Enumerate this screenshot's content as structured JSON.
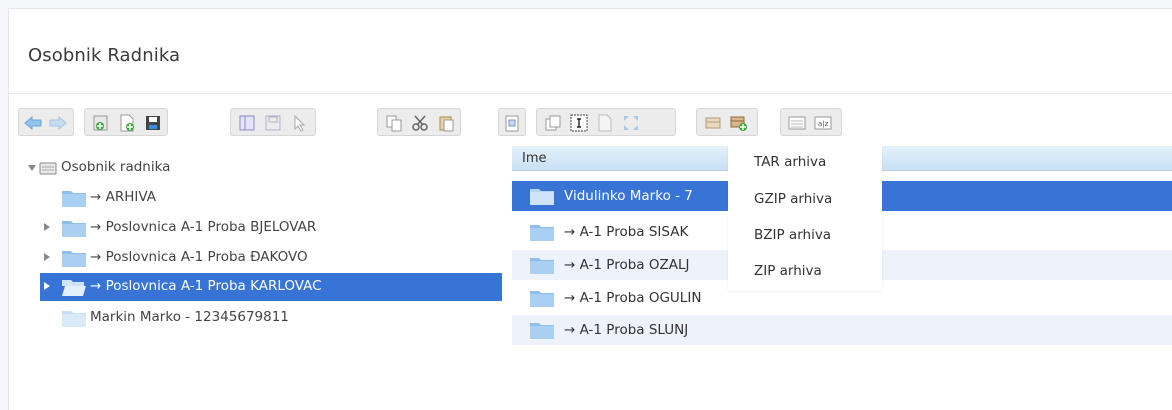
{
  "page": {
    "title": "Osobnik Radnika"
  },
  "toolbar": {
    "buttons": [
      "back-icon",
      "forward-icon",
      "new-folder-icon",
      "new-document-icon",
      "save-icon",
      "properties-icon",
      "save-disabled-icon",
      "pointer-icon",
      "copy-icon",
      "cut-icon",
      "paste-icon",
      "clipboard-icon",
      "duplicate-icon",
      "rename-icon",
      "edit-icon",
      "resize-icon",
      "archive-icon",
      "extract-icon",
      "list-view-icon",
      "sort-az-icon"
    ]
  },
  "tree": {
    "root": "Osobnik radnika",
    "items": [
      {
        "label": "→ ARHIVA",
        "expandable": false
      },
      {
        "label": "→ Poslovnica A-1 Proba BJELOVAR",
        "expandable": true
      },
      {
        "label": "→ Poslovnica A-1 Proba ĐAKOVO",
        "expandable": true
      },
      {
        "label": "→ Poslovnica A-1 Proba KARLOVAC",
        "expandable": true,
        "selected": true
      },
      {
        "label": "Markin Marko - 12345679811",
        "expandable": false
      }
    ]
  },
  "grid": {
    "header": "Ime",
    "rows": [
      {
        "name": "Vidulinko Marko - 7",
        "selected": true
      },
      {
        "name": "→ A-1 Proba SISAK"
      },
      {
        "name": "→ A-1 Proba OZALJ"
      },
      {
        "name": "→ A-1 Proba OGULIN"
      },
      {
        "name": "→  A-1 Proba SLUNJ"
      }
    ]
  },
  "menu": {
    "items": [
      "TAR arhiva",
      "GZIP arhiva",
      "BZIP arhiva",
      "ZIP arhiva"
    ]
  },
  "colors": {
    "selection": "#3774d6",
    "folder": "#8cbfec",
    "header_gradient_top": "#e4f1fb",
    "header_gradient_bottom": "#c8e0f4"
  }
}
